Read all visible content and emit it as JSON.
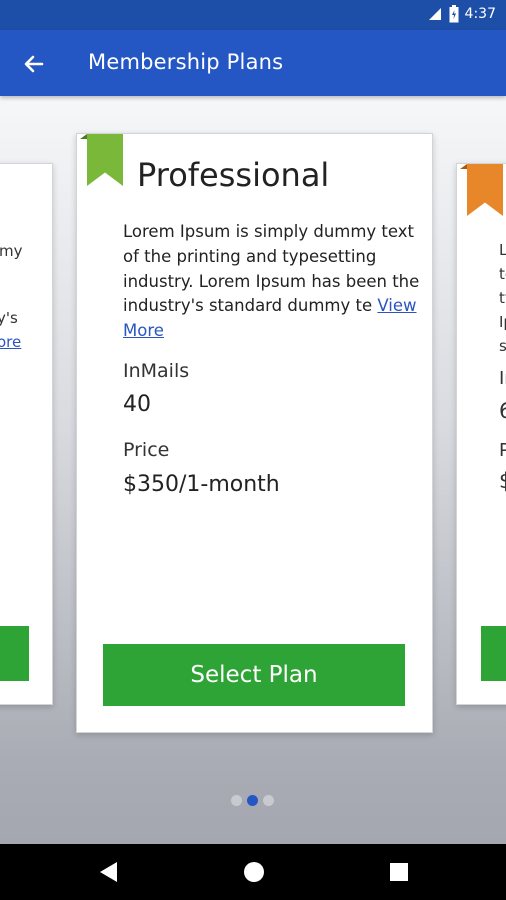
{
  "status_bar": {
    "time": "4:37",
    "icons": [
      "signal-icon",
      "battery-icon"
    ]
  },
  "app_bar": {
    "back_icon": "arrow-left-icon",
    "title": "Membership Plans"
  },
  "plans": {
    "left": {
      "ribbon_color": "#7ab83a",
      "text_fragments": [
        "my",
        "y's",
        "ore"
      ],
      "button_color": "#2ea436"
    },
    "current": {
      "name": "Professional",
      "ribbon_color": "#7ab83a",
      "description": "Lorem Ipsum is simply dummy text of the printing and typesetting industry. Lorem Ipsum has been the industry's standard dummy te",
      "view_more": "View More",
      "inmails_label": "InMails",
      "inmails_value": "40",
      "price_label": "Price",
      "price_value": "$350/1-month",
      "select_label": "Select Plan",
      "button_color": "#2ea436"
    },
    "right": {
      "ribbon_color": "#e8862a",
      "text_fragments": [
        "L",
        "te",
        "ty",
        "Ip",
        "st",
        "In",
        "6",
        "P",
        "$"
      ],
      "button_color": "#2ea436"
    }
  },
  "pager": {
    "count": 3,
    "active_index": 1
  },
  "colors": {
    "accent": "#2457c4",
    "status_bar": "#1d4fa8",
    "button_green": "#2ea436"
  },
  "nav_bar": {
    "icons": [
      "back-triangle-icon",
      "home-circle-icon",
      "recents-square-icon"
    ]
  }
}
